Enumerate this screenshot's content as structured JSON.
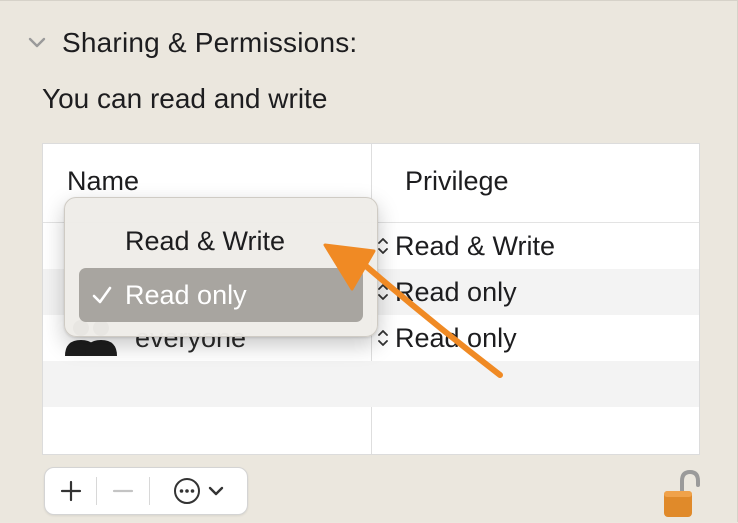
{
  "section": {
    "title": "Sharing & Permissions:",
    "disclosure_icon": "chevron-down-icon"
  },
  "subtitle": "You can read and write",
  "table": {
    "columns": [
      "Name",
      "Privilege"
    ],
    "rows": [
      {
        "name": "",
        "privilege": "Read & Write"
      },
      {
        "name": "",
        "privilege": "Read only"
      },
      {
        "name": "everyone",
        "privilege": "Read only",
        "icon": "group-icon"
      }
    ]
  },
  "popup_menu": {
    "items": [
      {
        "label": "Read & Write",
        "checked": false
      },
      {
        "label": "Read only",
        "checked": true,
        "highlighted": true
      }
    ]
  },
  "annotation": {
    "type": "arrow",
    "color": "#f08a24"
  },
  "toolbar": {
    "add_icon": "plus-icon",
    "remove_icon": "minus-icon",
    "more_icon": "ellipsis-circle-icon",
    "dropdown_icon": "chevron-down-icon"
  },
  "lock": {
    "icon": "lock-open-icon",
    "color": "#e08a2a"
  },
  "colors": {
    "menu_highlight": "#a8a5a0",
    "background": "#ebe7de",
    "accent_arrow": "#f08a24"
  }
}
